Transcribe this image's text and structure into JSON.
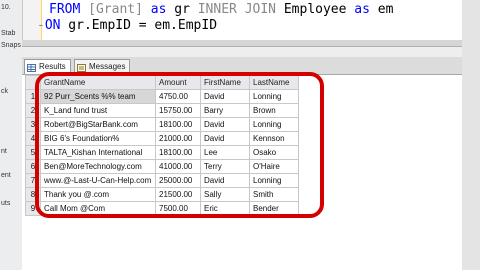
{
  "left_panel": {
    "fragments": [
      "10.",
      "Stab",
      "Snaps",
      "ck",
      "nt",
      "ent",
      "uts"
    ]
  },
  "editor": {
    "lines": [
      {
        "prefix": "  ",
        "keyword1": "FROM",
        "text1": " [Grant] ",
        "keyword2": "as",
        "text2": " gr ",
        "keyword3": "INNER JOIN",
        "text3": " Employee ",
        "keyword4": "as",
        "text4": " em"
      },
      {
        "prefix": " -",
        "keyword1": "ON",
        "text1": " gr.EmpID = em.EmpID"
      }
    ]
  },
  "tabs": [
    {
      "label": "Results",
      "icon": "grid-icon",
      "active": true
    },
    {
      "label": "Messages",
      "icon": "messages-icon",
      "active": false
    }
  ],
  "grid": {
    "columns": [
      "GrantName",
      "Amount",
      "FirstName",
      "LastName"
    ],
    "rows": [
      {
        "num": "1",
        "cells": [
          "92 Purr_Scents %% team",
          "4750.00",
          "David",
          "Lonning"
        ]
      },
      {
        "num": "2",
        "cells": [
          "K_Land fund trust",
          "15750.00",
          "Barry",
          "Brown"
        ]
      },
      {
        "num": "3",
        "cells": [
          "Robert@BigStarBank.com",
          "18100.00",
          "David",
          "Lonning"
        ]
      },
      {
        "num": "4",
        "cells": [
          "BIG 6's Foundation%",
          "21000.00",
          "David",
          "Kennson"
        ]
      },
      {
        "num": "5",
        "cells": [
          "TALTA_Kishan International",
          "18100.00",
          "Lee",
          "Osako"
        ]
      },
      {
        "num": "6",
        "cells": [
          "Ben@MoreTechnology.com",
          "41000.00",
          "Terry",
          "O'Haire"
        ]
      },
      {
        "num": "7",
        "cells": [
          "www.@-Last-U-Can-Help.com",
          "25000.00",
          "David",
          "Lonning"
        ]
      },
      {
        "num": "8",
        "cells": [
          "Thank you @.com",
          "21500.00",
          "Sally",
          "Smith"
        ]
      },
      {
        "num": "9",
        "cells": [
          "Call Mom @Com",
          "7500.00",
          "Eric",
          "Bender"
        ]
      }
    ]
  },
  "colors": {
    "keyword": "#0000ff",
    "annotation": "#d40000"
  }
}
